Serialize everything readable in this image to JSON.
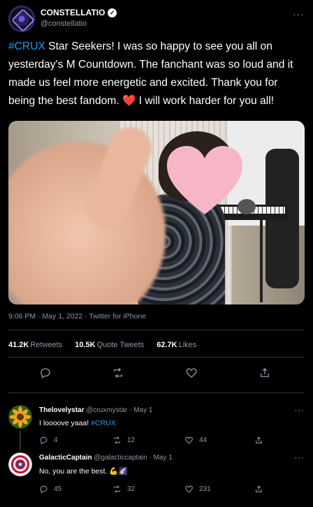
{
  "tweet": {
    "author_name": "CONSTELLATIO",
    "handle": "@constellatio",
    "text_tag": "#CRUX",
    "text_part1": " Star Seekers! I was so happy to see you all on yesterday's M Countdown. The fanchant was so loud and it made us feel more energetic and excited. Thank you for being the best fandom. ",
    "text_emoji": "❤️",
    "text_part2": " I will work harder for you all!",
    "meta": "9:06 PM · May 1, 2022 · Twitter for iPhone",
    "stats": {
      "retweets_count": "41.2K",
      "retweets_label": "Retweets",
      "quotes_count": "10.5K",
      "quotes_label": "Quote Tweets",
      "likes_count": "62.7K",
      "likes_label": "Likes"
    }
  },
  "replies": [
    {
      "name": "Thelovelystar",
      "handle_date": "@cruxmystar · May 1",
      "text": "I loooove yaaa! ",
      "tag": "#CRUX",
      "reply_count": "4",
      "retweet_count": "12",
      "like_count": "44"
    },
    {
      "name": "GalacticCaptain",
      "handle_date": "@galacticcaptain · May 1",
      "text": "No, you are the best. 💪🌠",
      "reply_count": "45",
      "retweet_count": "32",
      "like_count": "231"
    }
  ],
  "colors": {
    "background": "#000000",
    "accent": "#1d9bf0",
    "muted": "#8b98a5",
    "heart": "#e0245e"
  },
  "icons": [
    "verified-icon",
    "more-icon",
    "reply-icon",
    "retweet-icon",
    "like-icon",
    "share-icon"
  ]
}
